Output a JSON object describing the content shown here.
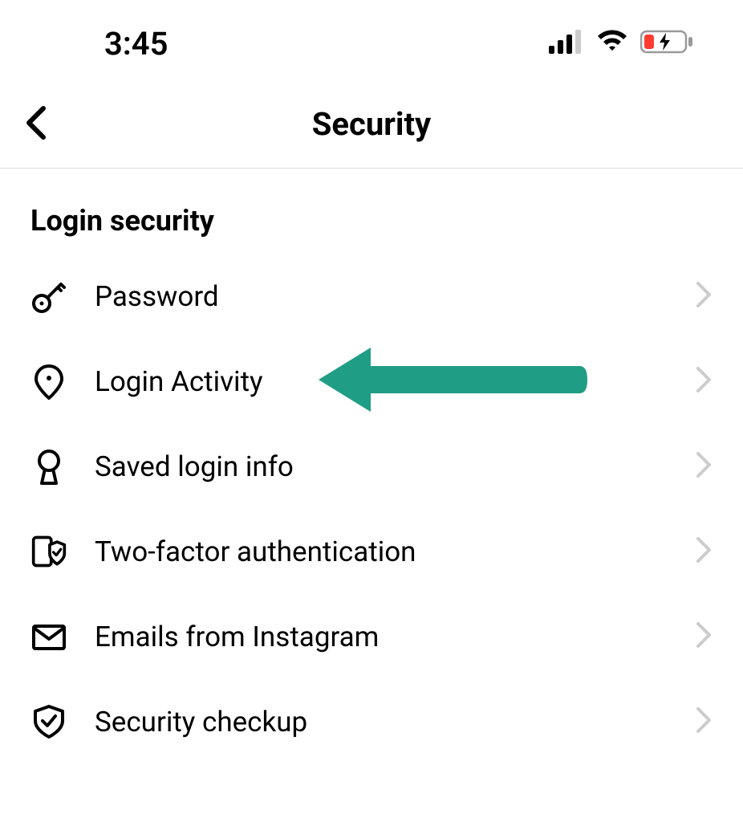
{
  "status_bar": {
    "time": "3:45"
  },
  "header": {
    "title": "Security"
  },
  "section": {
    "title": "Login security",
    "items": [
      {
        "label": "Password",
        "icon": "key-icon"
      },
      {
        "label": "Login Activity",
        "icon": "location-pin-icon",
        "highlighted": true
      },
      {
        "label": "Saved login info",
        "icon": "keyhole-icon"
      },
      {
        "label": "Two-factor authentication",
        "icon": "device-shield-icon"
      },
      {
        "label": "Emails from Instagram",
        "icon": "envelope-icon"
      },
      {
        "label": "Security checkup",
        "icon": "shield-check-icon"
      }
    ]
  },
  "annotation": {
    "arrow_color": "#1f9d85"
  }
}
